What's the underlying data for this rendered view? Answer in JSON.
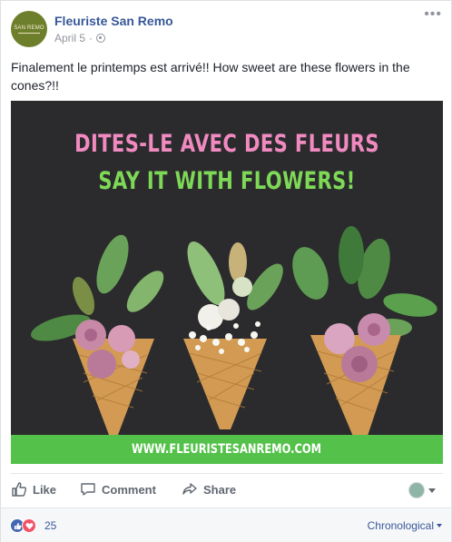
{
  "post": {
    "page_name": "Fleuriste San Remo",
    "avatar_text": "SAN REMO",
    "date": "April 5",
    "separator": "·",
    "privacy_icon": "globe-icon",
    "more_icon": "more-options-icon",
    "text": "Finalement le printemps est arrivé!! How sweet are these flowers in the cones?!!"
  },
  "image": {
    "headline_fr": "DITES-LE AVEC DES FLEURS",
    "headline_en": "SAY IT WITH FLOWERS!",
    "website": "WWW.FLEURISTESANREMO.COM",
    "colors": {
      "background": "#2b2b2d",
      "pink": "#f08ac0",
      "green": "#7ed957",
      "banner": "#54c14a"
    }
  },
  "actions": {
    "like": "Like",
    "comment": "Comment",
    "share": "Share"
  },
  "reactions": {
    "count": "25",
    "sort_label": "Chronological"
  },
  "colors": {
    "link": "#385898",
    "muted": "#90949c",
    "like_blue": "#4267b2",
    "love_red": "#f25268"
  }
}
